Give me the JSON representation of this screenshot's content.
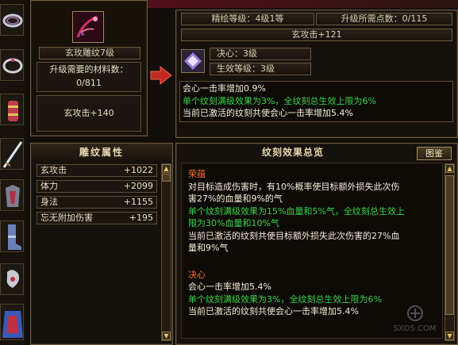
{
  "top_banner": "... ...(... ...)",
  "item": {
    "name": "玄玫雕纹7级",
    "materials_label": "升级需要的材料数：",
    "materials_value": "0/811",
    "attribute": "玄攻击+140"
  },
  "info": {
    "refine_level": "精绘等级：4级1等",
    "points_needed": "升级所需点数：0/115",
    "attack_bonus": "玄攻击+121",
    "skill_name": "决心：3级",
    "effect_level": "生效等级：3级"
  },
  "effect_box": {
    "line1": "会心一击率增加0.9%",
    "line2": "单个纹刻满级效果为3%，全纹刻总生效上限为6%",
    "line3": "当前已激活的纹刻共使会心一击率增加5.4%"
  },
  "left_table": {
    "title": "雕纹属性",
    "rows": [
      {
        "label": "玄攻击",
        "value": "+1022"
      },
      {
        "label": "体力",
        "value": "+2099"
      },
      {
        "label": "身法",
        "value": "+1155"
      },
      {
        "label": "忘无附加伤害",
        "value": "+195"
      }
    ]
  },
  "right_panel": {
    "title": "纹刻效果总览",
    "button": "图鉴",
    "section1_title": "荣蕴",
    "section1_lines": [
      "对目标造成伤害时，有10%概率使目标额外损失此次伤",
      "害27%的血量和9%的气"
    ],
    "section1_green": [
      "单个纹刻满级效果为15%血量和5%气，全纹刻总生效上",
      "限为30%血量和10%气"
    ],
    "section1_active": [
      "当前已激活的纹刻共使目标额外损失此次伤害的27%血",
      "量和9%气"
    ],
    "section2_title": "决心",
    "section2_line": "会心一击率增加5.4%",
    "section2_green": "单个纹刻满级效果为3%，全纹刻总生效上限为6%",
    "section2_active": "当前已激活的纹刻共使会心一击率增加5.4%"
  },
  "watermark": "SXDS.COM",
  "colors": {
    "green": "#35d34a",
    "orange": "#ff6a24",
    "border": "#6b5a3e"
  }
}
